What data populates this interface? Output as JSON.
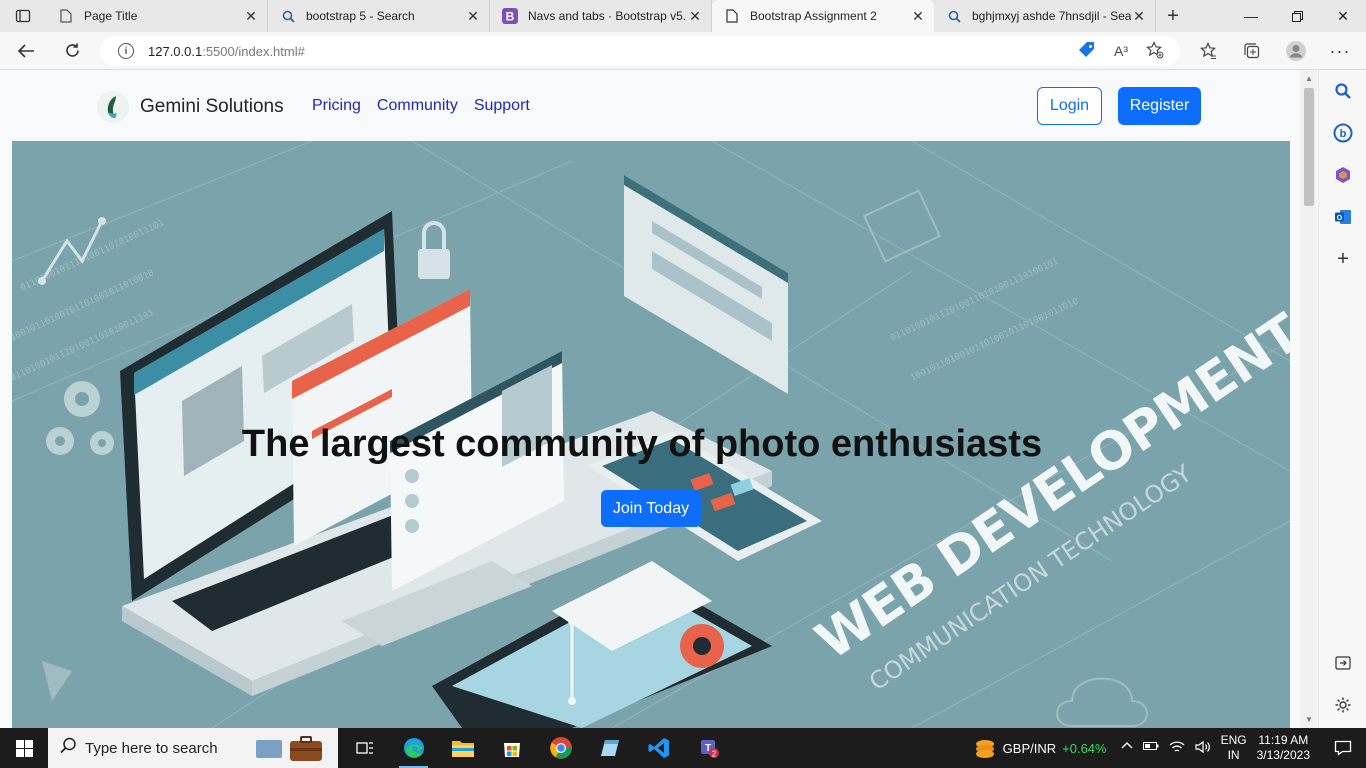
{
  "browser": {
    "tabs": [
      {
        "title": "Page Title",
        "icon": "page-icon",
        "active": false
      },
      {
        "title": "bootstrap 5 - Search",
        "icon": "search-icon",
        "active": false
      },
      {
        "title": "Navs and tabs · Bootstrap v5.",
        "icon": "bootstrap-icon",
        "active": false
      },
      {
        "title": "Bootstrap Assignment 2",
        "icon": "page-icon",
        "active": true
      },
      {
        "title": "bghjmxyj ashde 7hnsdjil - Sea",
        "icon": "search-icon",
        "active": false
      }
    ],
    "url_host": "127.0.0.1",
    "url_rest": ":5500/index.html#",
    "read_aloud": "A³"
  },
  "site": {
    "brand": "Gemini Solutions",
    "nav": [
      "Pricing",
      "Community",
      "Support"
    ],
    "login": "Login",
    "register": "Register",
    "hero_title": "The largest community of photo enthusiasts",
    "join": "Join Today",
    "hero_art_text1": "WEB DEVELOPMENT",
    "hero_art_text2": "COMMUNICATION TECHNOLOGY"
  },
  "taskbar": {
    "search_placeholder": "Type here to search",
    "stock_name": "GBP/INR",
    "stock_change": "+0.64%",
    "lang1": "ENG",
    "lang2": "IN",
    "time": "11:19 AM",
    "date": "3/13/2023",
    "teams_badge": "2"
  },
  "colors": {
    "accent": "#0d6efd",
    "nav_link": "#1f2ab7",
    "hero_bg": "#7aa3ab"
  }
}
